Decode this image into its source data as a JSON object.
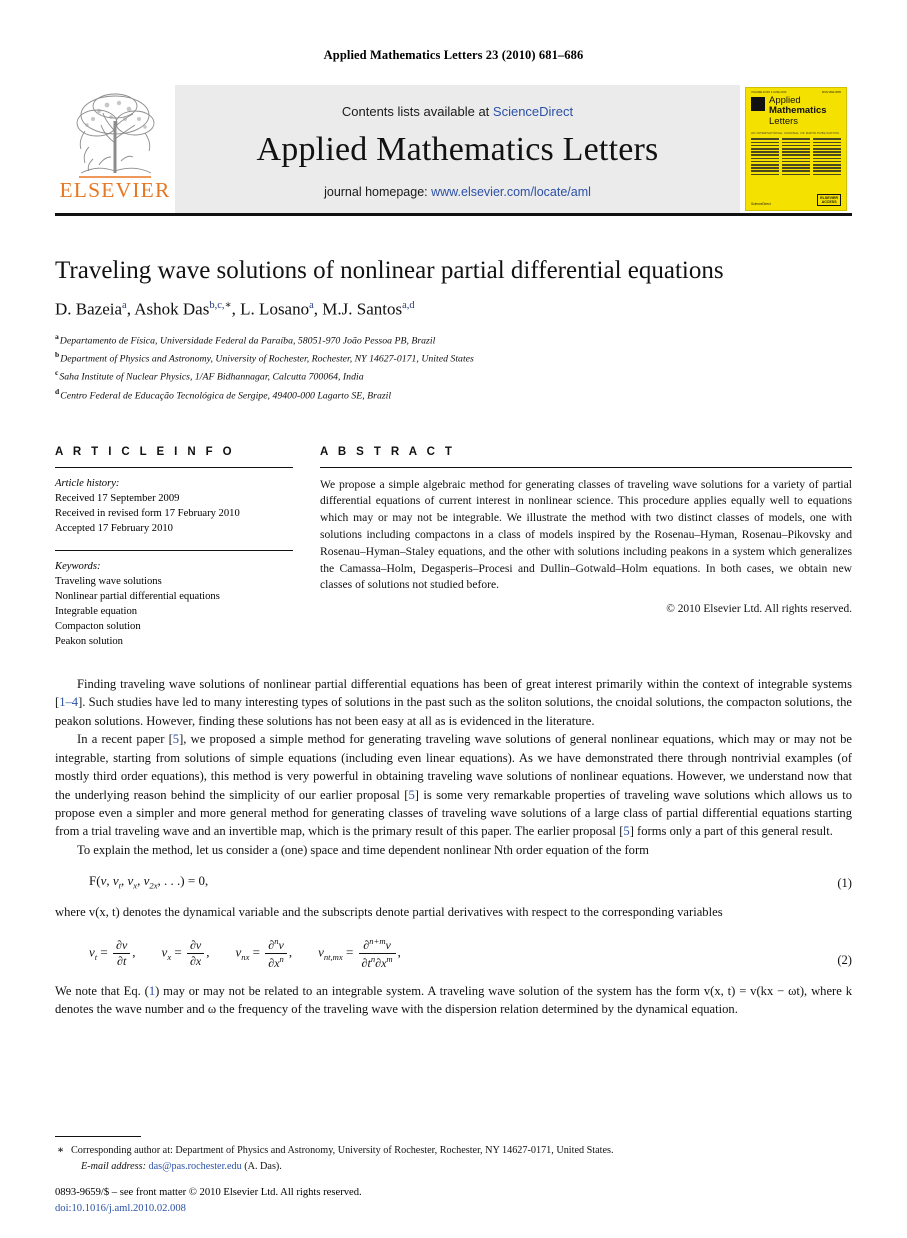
{
  "running_head": "Applied Mathematics Letters 23 (2010) 681–686",
  "masthead": {
    "contents_prefix": "Contents lists available at ",
    "contents_link": "ScienceDirect",
    "journal_title": "Applied Mathematics Letters",
    "homepage_prefix": "journal homepage: ",
    "homepage_link": "www.elsevier.com/locate/aml",
    "publisher_word": "ELSEVIER",
    "publisher_color": "#E87722",
    "cover": {
      "title_line1": "Applied",
      "title_line2": "Mathematics",
      "title_line3": "Letters",
      "background_color": "#f5e100",
      "sciencedirect_label": "ScienceDirect",
      "badge_line1": "ELSEVIER",
      "badge_line2": "ACCESS"
    }
  },
  "article": {
    "title": "Traveling wave solutions of nonlinear partial differential equations",
    "authors": [
      {
        "name": "D. Bazeia",
        "marks": "a"
      },
      {
        "name": "Ashok Das",
        "marks": "b,c,",
        "star": "∗"
      },
      {
        "name": "L. Losano",
        "marks": "a"
      },
      {
        "name": "M.J. Santos",
        "marks": "a,d"
      }
    ],
    "affiliations": [
      {
        "mark": "a",
        "text": "Departamento de Física, Universidade Federal da Paraíba, 58051-970 João Pessoa PB, Brazil"
      },
      {
        "mark": "b",
        "text": "Department of Physics and Astronomy, University of Rochester, Rochester, NY 14627-0171, United States"
      },
      {
        "mark": "c",
        "text": "Saha Institute of Nuclear Physics, 1/AF Bidhannagar, Calcutta 700064, India"
      },
      {
        "mark": "d",
        "text": "Centro Federal de Educação Tecnológica de Sergipe, 49400-000 Lagarto SE, Brazil"
      }
    ]
  },
  "info": {
    "heading": "A R T I C L E  I N F O",
    "history_label": "Article history:",
    "history": [
      "Received 17 September 2009",
      "Received in revised form 17 February 2010",
      "Accepted 17 February 2010"
    ],
    "keywords_label": "Keywords:",
    "keywords": [
      "Traveling wave solutions",
      "Nonlinear partial differential equations",
      "Integrable equation",
      "Compacton solution",
      "Peakon solution"
    ]
  },
  "abstract": {
    "heading": "A B S T R A C T",
    "text": "We propose a simple algebraic method for generating classes of traveling wave solutions for a variety of partial differential equations of current interest in nonlinear science. This procedure applies equally well to equations which may or may not be integrable. We illustrate the method with two distinct classes of models, one with solutions including compactons in a class of models inspired by the Rosenau–Hyman, Rosenau–Pikovsky and Rosenau–Hyman–Staley equations, and the other with solutions including peakons in a system which generalizes the Camassa–Holm, Degasperis–Procesi and Dullin–Gotwald–Holm equations. In both cases, we obtain new classes of solutions not studied before.",
    "copyright": "© 2010 Elsevier Ltd. All rights reserved."
  },
  "body": {
    "para1_a": "Finding traveling wave solutions of nonlinear partial differential equations has been of great interest primarily within the context of integrable systems [",
    "para1_ref": "1–4",
    "para1_b": "]. Such studies have led to many interesting types of solutions in the past such as the soliton solutions, the cnoidal solutions, the compacton solutions, the peakon solutions. However, finding these solutions has not been easy at all as is evidenced in the literature.",
    "para2_a": "In a recent paper [",
    "para2_ref1": "5",
    "para2_b": "], we proposed a simple method for generating traveling wave solutions of general nonlinear equations, which may or may not be integrable, starting from solutions of simple equations (including even linear equations). As we have demonstrated there through nontrivial examples (of mostly third order equations), this method is very powerful in obtaining traveling wave solutions of nonlinear equations. However, we understand now that the underlying reason behind the simplicity of our earlier proposal [",
    "para2_ref2": "5",
    "para2_c": "] is some very remarkable properties of traveling wave solutions which allows us to propose even a simpler and more general method for generating classes of traveling wave solutions of a large class of partial differential equations starting from a trial traveling wave and an invertible map, which is the primary result of this paper. The earlier proposal [",
    "para2_ref3": "5",
    "para2_d": "] forms only a part of this general result.",
    "para3": "To explain the method, let us consider a (one) space and time dependent nonlinear Nth order equation of the form",
    "eq1_number": "(1)",
    "after_eq1": "where v(x, t) denotes the dynamical variable and the subscripts denote partial derivatives with respect to the corresponding variables",
    "eq2_number": "(2)",
    "after_eq2_a": "We note that Eq. (",
    "after_eq2_ref": "1",
    "after_eq2_b": ") may or may not be related to an integrable system. A traveling wave solution of the system has the form v(x, t) = v(kx − ωt), where k denotes the wave number and ω the frequency of the traveling wave with the dispersion relation determined by the dynamical equation."
  },
  "footnotes": {
    "star_marker": "∗",
    "corresponding": "Corresponding author at: Department of Physics and Astronomy, University of Rochester, Rochester, NY 14627-0171, United States.",
    "email_label": "E-mail address:",
    "email": "das@pas.rochester.edu",
    "email_suffix": "(A. Das).",
    "issn_line": "0893-9659/$ – see front matter © 2010 Elsevier Ltd. All rights reserved.",
    "doi_line": "doi:10.1016/j.aml.2010.02.008"
  }
}
